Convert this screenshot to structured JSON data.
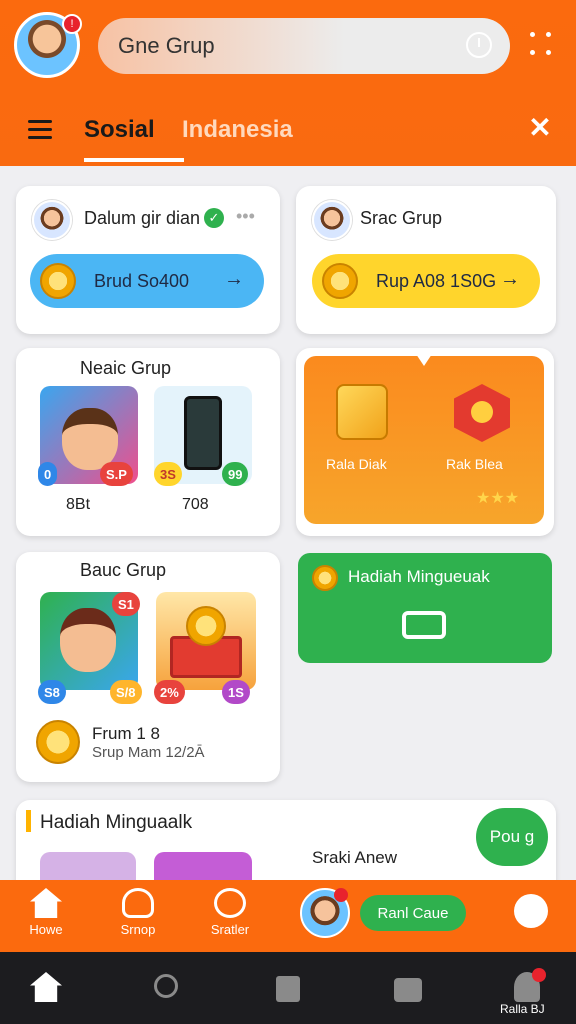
{
  "header": {
    "search_text": "Gne Grup",
    "avatar_badge": "!"
  },
  "tabs": {
    "active": "Sosial",
    "secondary": "Indanesia"
  },
  "cards": {
    "group1": {
      "title": "Dalum gir dian",
      "button": "Brud So400"
    },
    "group2": {
      "title": "Srac Grup",
      "button": "Rup A08 1S0G"
    },
    "news": {
      "title": "Neaic Grup",
      "thumb1_tags": [
        "0",
        "S.P"
      ],
      "thumb2_tags": [
        "3S",
        "99"
      ],
      "thumb1_caption": "8Bt",
      "thumb2_caption": "708"
    },
    "promo": {
      "left_label": "Rala Diak",
      "right_label": "Rak Blea",
      "stars": "★★★"
    },
    "reward_green": {
      "title": "Hadiah Mingueuak"
    },
    "bottom_group": {
      "title": "Bauc Grup",
      "thumb1_tags": [
        "S1",
        "S8",
        "S/8"
      ],
      "thumb2_tags": [
        "2%",
        "1S"
      ],
      "caption1": "Frum 1 8",
      "caption2": "Srup Mam 12/2Ā"
    },
    "weekly": {
      "title": "Hadiah Minguaalk",
      "side_text": "Sraki Anew",
      "button": "Pou g"
    }
  },
  "bottom_nav": {
    "home": "Howe",
    "shop": "Srnop",
    "stats": "Sratler",
    "action_button": "Ranl Caue"
  },
  "system_bar": {
    "corner_text": "Ralla BJ"
  },
  "colors": {
    "primary_orange": "#fb6a0e",
    "blue_pill": "#4bb6f4",
    "yellow_pill": "#ffd52c",
    "green": "#2fb14e"
  }
}
